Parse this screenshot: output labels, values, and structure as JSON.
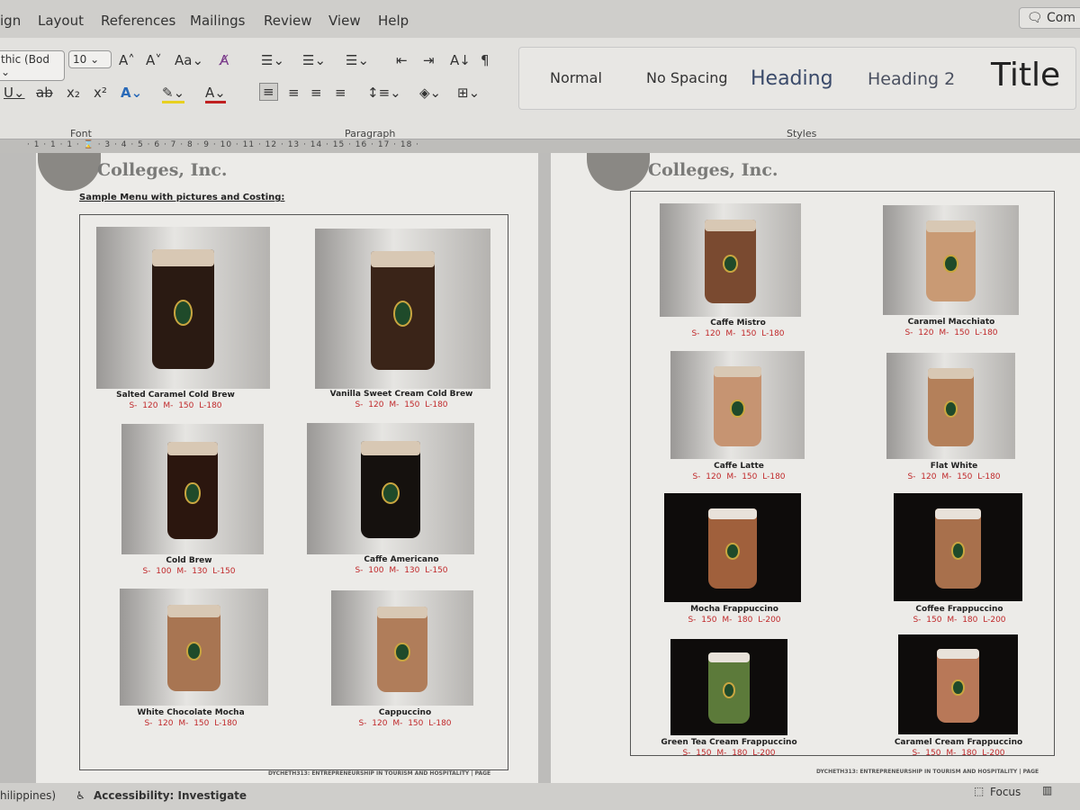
{
  "tabs": [
    "ign",
    "Layout",
    "References",
    "Mailings",
    "Review",
    "View",
    "Help"
  ],
  "comments_label": "Com",
  "ribbon": {
    "font_name": "thic (Bod",
    "font_size": "10",
    "groups": {
      "font": "Font",
      "paragraph": "Paragraph",
      "styles": "Styles"
    },
    "styles": [
      "Normal",
      "No Spacing",
      "Heading",
      "Heading 2",
      "Title"
    ]
  },
  "ruler": "· 1 · 1 · 1 · ⌛ · 3 · 4 · 5 · 6 · 7 · 8 · 9 · 10 · 11 · 12 · 13 · 14 · 15 · 16 · 17 · 18 ·",
  "document": {
    "college": "Colleges, Inc.",
    "subtitle": "Sample Menu with pictures and Costing:",
    "footer": "DYCHETH313: ENTREPRENEURSHIP IN TOURISM AND HOSPITALITY | PAGE",
    "price_color": "#c0282a",
    "items": [
      {
        "name": "Salted Caramel Cold Brew",
        "prices": "S- 120  M- 150  L-180",
        "cup": "#2a1a12",
        "bg": "light"
      },
      {
        "name": "Vanilla Sweet Cream Cold Brew",
        "prices": "S- 120  M- 150  L-180",
        "cup": "#3a2418",
        "bg": "light"
      },
      {
        "name": "Cold Brew",
        "prices": "S- 100  M- 130  L-150",
        "cup": "#2b160e",
        "bg": "light"
      },
      {
        "name": "Caffe Americano",
        "prices": "S- 100  M- 130  L-150",
        "cup": "#15110e",
        "bg": "light"
      },
      {
        "name": "White Chocolate Mocha",
        "prices": "S- 120  M- 150  L-180",
        "cup": "#a87552",
        "bg": "light"
      },
      {
        "name": "Cappuccino",
        "prices": "S- 120  M- 150  L-180",
        "cup": "#b07d5a",
        "bg": "light"
      },
      {
        "name": "Caffe Mistro",
        "prices": "S- 120  M- 150  L-180",
        "cup": "#7a4a30",
        "bg": "light"
      },
      {
        "name": "Caramel Macchiato",
        "prices": "S- 120  M- 150  L-180",
        "cup": "#c99a74",
        "bg": "light"
      },
      {
        "name": "Caffe Latte",
        "prices": "S- 120  M- 150  L-180",
        "cup": "#c69472",
        "bg": "light"
      },
      {
        "name": "Flat White",
        "prices": "S- 120  M- 150  L-180",
        "cup": "#b4805a",
        "bg": "light"
      },
      {
        "name": "Mocha Frappuccino",
        "prices": "S- 150  M- 180  L-200",
        "cup": "#a0603c",
        "bg": "dark"
      },
      {
        "name": "Coffee Frappuccino",
        "prices": "S- 150  M- 180  L-200",
        "cup": "#a8704c",
        "bg": "dark"
      },
      {
        "name": "Green Tea Cream Frappuccino",
        "prices": "S- 150  M- 180  L-200",
        "cup": "#5c7a3a",
        "bg": "dark"
      },
      {
        "name": "Caramel Cream Frappuccino",
        "prices": "S- 150  M- 180  L-200",
        "cup": "#b87858",
        "bg": "dark"
      }
    ]
  },
  "status": {
    "language": "hilippines)",
    "accessibility": "Accessibility: Investigate",
    "focus": "Focus"
  }
}
